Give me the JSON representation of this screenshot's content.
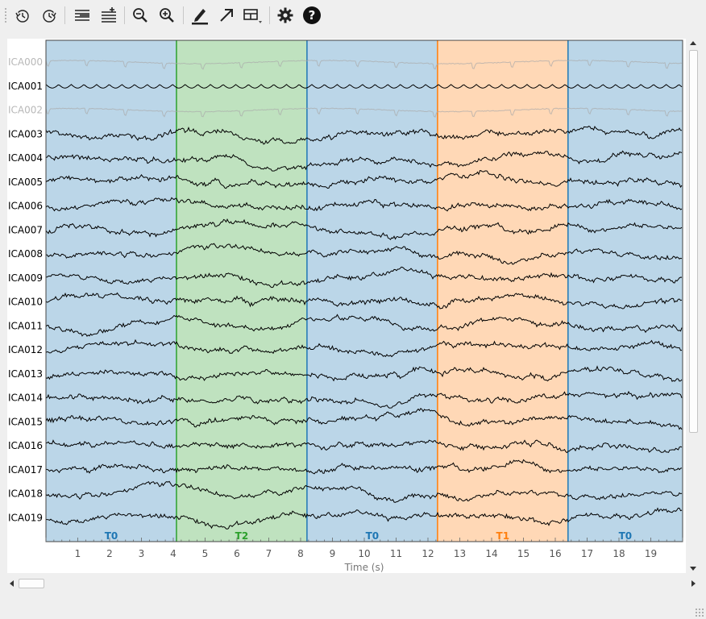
{
  "toolbar": {
    "buttons": [
      {
        "name": "rewind-icon",
        "tooltip": ""
      },
      {
        "name": "fast-forward-icon",
        "tooltip": ""
      },
      {
        "name": "fewer-channels-icon",
        "tooltip": ""
      },
      {
        "name": "more-channels-icon",
        "tooltip": ""
      },
      {
        "name": "zoom-out-icon",
        "tooltip": ""
      },
      {
        "name": "zoom-in-icon",
        "tooltip": ""
      },
      {
        "name": "annotation-pen-icon",
        "tooltip": ""
      },
      {
        "name": "projector-arrow-icon",
        "tooltip": ""
      },
      {
        "name": "overview-grid-icon",
        "tooltip": ""
      },
      {
        "name": "settings-gear-icon",
        "tooltip": ""
      },
      {
        "name": "help-icon",
        "tooltip": ""
      }
    ]
  },
  "chart_data": {
    "type": "line",
    "title": "",
    "xlabel": "Time (s)",
    "ylabel": "",
    "xlim": [
      0,
      20
    ],
    "xticks": [
      "1",
      "2",
      "3",
      "4",
      "5",
      "6",
      "7",
      "8",
      "9",
      "10",
      "11",
      "12",
      "13",
      "14",
      "15",
      "16",
      "17",
      "18",
      "19"
    ],
    "grid": false,
    "channels": [
      {
        "name": "ICA000",
        "bad": true
      },
      {
        "name": "ICA001",
        "bad": false
      },
      {
        "name": "ICA002",
        "bad": true
      },
      {
        "name": "ICA003",
        "bad": false
      },
      {
        "name": "ICA004",
        "bad": false
      },
      {
        "name": "ICA005",
        "bad": false
      },
      {
        "name": "ICA006",
        "bad": false
      },
      {
        "name": "ICA007",
        "bad": false
      },
      {
        "name": "ICA008",
        "bad": false
      },
      {
        "name": "ICA009",
        "bad": false
      },
      {
        "name": "ICA010",
        "bad": false
      },
      {
        "name": "ICA011",
        "bad": false
      },
      {
        "name": "ICA012",
        "bad": false
      },
      {
        "name": "ICA013",
        "bad": false
      },
      {
        "name": "ICA014",
        "bad": false
      },
      {
        "name": "ICA015",
        "bad": false
      },
      {
        "name": "ICA016",
        "bad": false
      },
      {
        "name": "ICA017",
        "bad": false
      },
      {
        "name": "ICA018",
        "bad": false
      },
      {
        "name": "ICA019",
        "bad": false
      }
    ],
    "annotations": [
      {
        "label": "T0",
        "start": 0.0,
        "end": 4.1,
        "color": "#1f77b4"
      },
      {
        "label": "T2",
        "start": 4.1,
        "end": 8.2,
        "color": "#2ca02c"
      },
      {
        "label": "T0",
        "start": 8.2,
        "end": 12.3,
        "color": "#1f77b4"
      },
      {
        "label": "T1",
        "start": 12.3,
        "end": 16.4,
        "color": "#ff7f0e"
      },
      {
        "label": "T0",
        "start": 16.4,
        "end": 20.0,
        "color": "#1f77b4"
      }
    ],
    "colors": {
      "trace": "#000000",
      "bad_trace": "#aaaaaa",
      "bad_label": "#b8b8b8",
      "label": "#000000"
    }
  }
}
